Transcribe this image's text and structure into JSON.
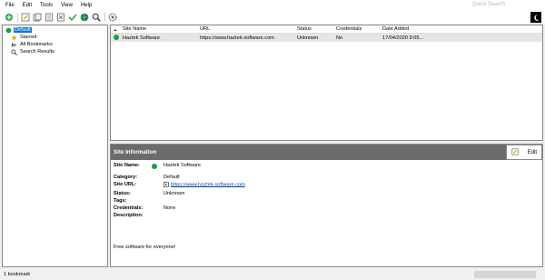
{
  "menu": [
    "File",
    "Edit",
    "Tools",
    "View",
    "Help"
  ],
  "quick_search_placeholder": "Quick Search",
  "toolbar": {
    "icons": [
      "add-bookmark-icon",
      "edit-icon",
      "copy-icon",
      "properties-icon",
      "delete-icon",
      "check-icon",
      "globe-icon",
      "search-icon",
      "settings-icon"
    ]
  },
  "sidebar": {
    "items": [
      {
        "label": "Default",
        "icon": "green-dot-icon",
        "selected": true
      },
      {
        "label": "Starred",
        "icon": "star-icon"
      },
      {
        "label": "All Bookmarks",
        "icon": "bookmarks-icon"
      },
      {
        "label": "Search Results",
        "icon": "search-icon"
      }
    ]
  },
  "list": {
    "columns": [
      "Site Name",
      "URL",
      "Status",
      "Credentials",
      "Date Added"
    ],
    "sort_indicator": "▲",
    "rows": [
      {
        "name": "Haztek Software",
        "url": "https://www.haztek-software.com",
        "status": "Unknown",
        "credentials": "No",
        "date": "17/04/2020 9:05..."
      }
    ]
  },
  "info": {
    "title": "Site Information",
    "edit_label": "Edit",
    "site_name_label": "Site Name:",
    "site_name": "Haztek Software",
    "category_label": "Category:",
    "category": "Default",
    "site_url_label": "Site URL:",
    "site_url": "https://www.haztek-software.com",
    "status_label": "Status:",
    "status": "Unknown",
    "tags_label": "Tags:",
    "credentials_label": "Credentials:",
    "credentials": "None",
    "description_label": "Description:",
    "description": "Free software for everyone!"
  },
  "statusbar": {
    "text": "1 bookmark"
  },
  "colors": {
    "accent": "#0078d7",
    "status_dot": "#1a9e4a",
    "header_bar": "#6b6b6b"
  }
}
